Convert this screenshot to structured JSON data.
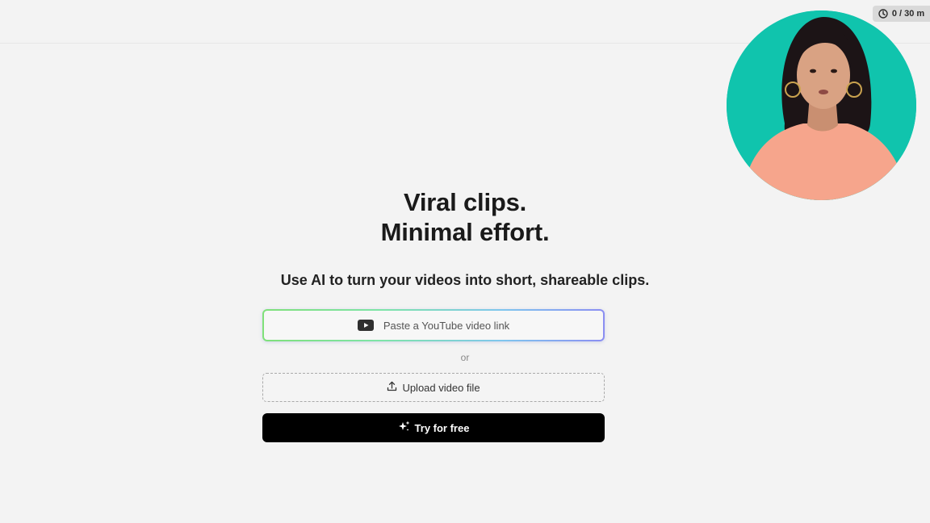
{
  "timer": {
    "label": "0 / 30 m",
    "icon": "clock-icon"
  },
  "hero": {
    "headline_line1": "Viral clips.",
    "headline_line2": "Minimal effort.",
    "subline": "Use AI to turn your videos into short, shareable clips."
  },
  "youtube_input": {
    "placeholder": "Paste a YouTube video link",
    "icon": "youtube-icon"
  },
  "divider_text": "or",
  "upload": {
    "label": "Upload video file",
    "icon": "upload-icon"
  },
  "cta": {
    "label": "Try for free",
    "icon": "sparkles-icon"
  },
  "presenter": {
    "icon": "presenter-video"
  },
  "colors": {
    "page_bg": "#f3f3f3",
    "cta_bg": "#000000",
    "presenter_bg": "#10c4ad",
    "gradient_start": "#7fe07a",
    "gradient_end": "#8b8ef2"
  }
}
